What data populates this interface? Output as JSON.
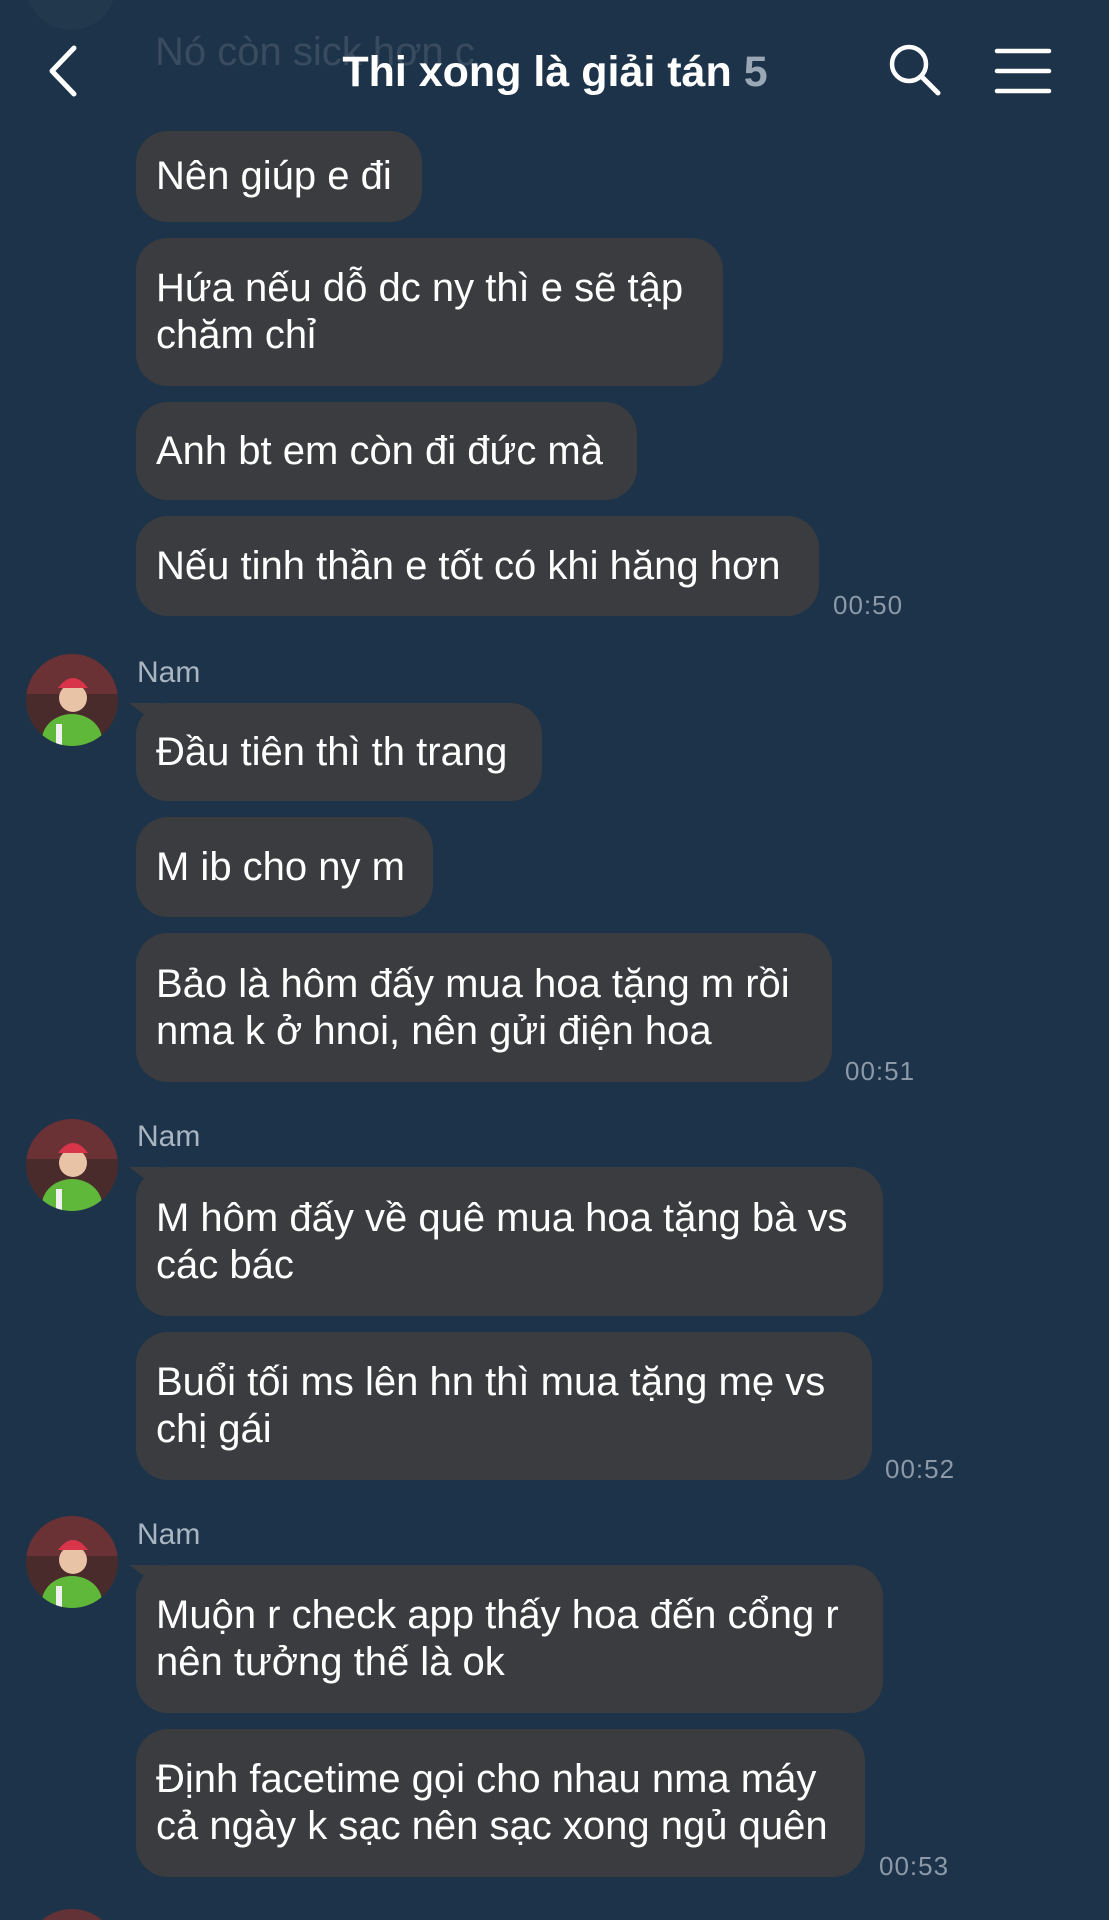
{
  "header": {
    "title": "Thi xong là giải tán",
    "member_count": "5",
    "back_icon": "chevron-left-icon",
    "search_icon": "search-icon",
    "menu_icon": "hamburger-menu-icon",
    "pinned_preview": "Nó còn sick hơn c"
  },
  "messages": [
    {
      "lines": [
        "Nên giúp e đi"
      ]
    },
    {
      "lines": [
        "Hứa nếu dỗ dc ny thì e sẽ tập",
        "chăm chỉ"
      ]
    },
    {
      "lines": [
        "Anh bt em còn đi đức mà"
      ]
    },
    {
      "lines": [
        "Nếu tinh thần e tốt có khi hăng hơn"
      ],
      "time": "00:50"
    },
    {
      "sender": "Nam",
      "lines": [
        "Đầu tiên thì th trang"
      ]
    },
    {
      "lines": [
        "M ib cho ny m"
      ]
    },
    {
      "lines": [
        "Bảo là hôm đấy mua hoa tặng m rồi",
        "nma k ở hnoi, nên gửi điện hoa"
      ],
      "time": "00:51"
    },
    {
      "sender": "Nam",
      "lines": [
        "M hôm đấy về quê mua hoa tặng bà vs",
        "các bác"
      ]
    },
    {
      "lines": [
        "Buổi tối ms lên hn thì mua tặng mẹ vs",
        "chị gái"
      ],
      "time": "00:52"
    },
    {
      "sender": "Nam",
      "lines": [
        "Muộn r check app thấy hoa đến cổng r",
        "nên tưởng thế là ok"
      ]
    },
    {
      "lines": [
        "Định facetime gọi cho nhau nma máy",
        "cả ngày k sạc nên sạc xong ngủ quên"
      ],
      "time": "00:53"
    }
  ],
  "colors": {
    "background": "#1d3349",
    "bubble": "#3b3c3f",
    "timestamp": "#8b99a8",
    "sender_name": "#a9b6c2",
    "member_count": "#9aa7b4"
  }
}
